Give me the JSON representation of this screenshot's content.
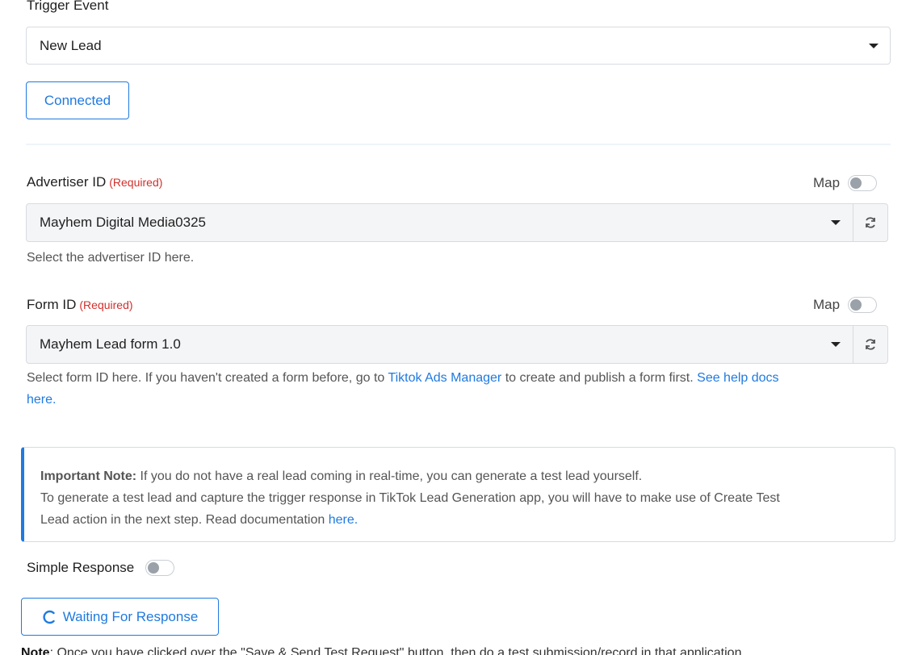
{
  "trigger": {
    "label": "Trigger Event",
    "value": "New Lead"
  },
  "connected_label": "Connected",
  "advertiser": {
    "label": "Advertiser ID",
    "required": "(Required)",
    "map_label": "Map",
    "value": "Mayhem Digital Media0325",
    "helper": "Select the advertiser ID here."
  },
  "form": {
    "label": "Form ID",
    "required": "(Required)",
    "map_label": "Map",
    "value": "Mayhem Lead form 1.0",
    "helper_pre": "Select form ID here. If you haven't created a form before, go to ",
    "helper_link1": "Tiktok Ads Manager",
    "helper_mid": " to create and publish a form first. ",
    "helper_link2_line1": "See help docs",
    "helper_link2_line2": "here."
  },
  "note": {
    "title": "Important Note:",
    "line1": " If you do not have a real lead coming in real-time, you can generate a test lead yourself.",
    "line2": "To generate a test lead and capture the trigger response in TikTok Lead Generation app, you will have to make use of Create Test",
    "line3_pre": "Lead action in the next step. Read documentation ",
    "line3_link": "here."
  },
  "simple_response_label": "Simple Response",
  "waiting_label": "Waiting For Response",
  "bottom_note": {
    "bold": "Note",
    "text": ": Once you have clicked over the \"Save & Send Test Request\" button, then do a test submission/record in that application."
  },
  "colors": {
    "accent": "#1f7ae0",
    "required": "#d0302c"
  }
}
